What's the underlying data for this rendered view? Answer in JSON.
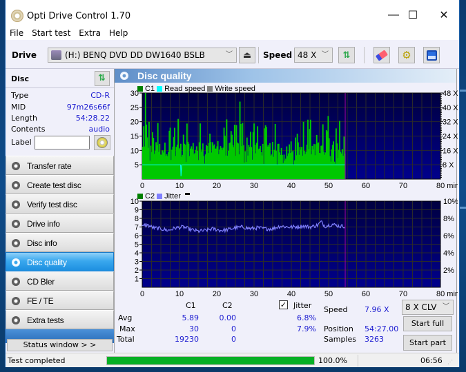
{
  "window": {
    "title": "Opti Drive Control 1.70",
    "controls": {
      "minimize": "—",
      "maximize": "☐",
      "close": "✕"
    }
  },
  "menu": [
    "File",
    "Start test",
    "Extra",
    "Help"
  ],
  "toolbar": {
    "drive_label": "Drive",
    "drive_value": "(H:)   BENQ DVD DD DW1640 BSLB",
    "speed_label": "Speed",
    "speed_value": "48 X",
    "icons": [
      "eject-icon",
      "refresh-icon",
      "erase-icon",
      "settings-icon",
      "save-icon"
    ]
  },
  "disc": {
    "heading": "Disc",
    "fields": [
      {
        "label": "Type",
        "value": "CD-R"
      },
      {
        "label": "MID",
        "value": "97m26s66f"
      },
      {
        "label": "Length",
        "value": "54:28.22"
      },
      {
        "label": "Contents",
        "value": "audio"
      }
    ],
    "label_field": {
      "label": "Label",
      "value": ""
    }
  },
  "nav": [
    {
      "label": "Transfer rate",
      "active": false
    },
    {
      "label": "Create test disc",
      "active": false
    },
    {
      "label": "Verify test disc",
      "active": false
    },
    {
      "label": "Drive info",
      "active": false
    },
    {
      "label": "Disc info",
      "active": false
    },
    {
      "label": "Disc quality",
      "active": true
    },
    {
      "label": "CD Bler",
      "active": false
    },
    {
      "label": "FE / TE",
      "active": false
    },
    {
      "label": "Extra tests",
      "active": false
    }
  ],
  "status_window_button": "Status window > >",
  "panel": {
    "title": "Disc quality"
  },
  "colors": {
    "c1": "#00c800",
    "c2": "#008000",
    "read_speed": "#00ffff",
    "write_speed": "#808080",
    "jitter": "#8080ff",
    "plot_bg_top": "#000040",
    "plot_bg_bottom": "#00008c",
    "end_marker": "#a000a0",
    "progress": "#06b025",
    "value_text": "#1a1ad0"
  },
  "chart_data": [
    {
      "type": "bar",
      "title": "C1 / Read speed",
      "legend": [
        "C1",
        "Read speed",
        "Write speed"
      ],
      "legend_position": "top-left",
      "xlabel": "min",
      "x_ticks": [
        "0",
        "10",
        "20",
        "30",
        "40",
        "50",
        "60",
        "70",
        "80 min"
      ],
      "xlim": [
        0,
        80
      ],
      "ylim": [
        0,
        30
      ],
      "y_ticks": [
        "5",
        "10",
        "15",
        "20",
        "25",
        "30"
      ],
      "y2_ticks": [
        "8 X",
        "16 X",
        "24 X",
        "32 X",
        "40 X",
        "48 X"
      ],
      "y2lim": [
        0,
        48
      ],
      "grid": true,
      "data_end_min": 54.45,
      "series": [
        {
          "name": "C1",
          "profile": "dense bars, baseline ~5-12, frequent spikes 15-23, max 30 near 1 min, 27 near 26 min, 22 near 51 min",
          "max": 30,
          "avg": 5.89
        },
        {
          "name": "Read speed",
          "constant_x": 7.96,
          "dip_at_min": 10.5
        }
      ]
    },
    {
      "type": "line",
      "title": "C2 / Jitter",
      "legend": [
        "C2",
        "Jitter"
      ],
      "legend_position": "top-left",
      "xlabel": "min",
      "x_ticks": [
        "0",
        "10",
        "20",
        "30",
        "40",
        "50",
        "60",
        "70",
        "80 min"
      ],
      "xlim": [
        0,
        80
      ],
      "ylim": [
        0,
        10
      ],
      "y_ticks": [
        "1",
        "2",
        "3",
        "4",
        "5",
        "6",
        "7",
        "8",
        "9",
        "10"
      ],
      "y2_ticks": [
        "2%",
        "4%",
        "6%",
        "8%",
        "10%"
      ],
      "y2lim": [
        0,
        10
      ],
      "grid": true,
      "data_end_min": 54.45,
      "series": [
        {
          "name": "C2",
          "values_all": 0
        },
        {
          "name": "Jitter",
          "unit": "%",
          "x": [
            0,
            1,
            3,
            5,
            7,
            9,
            11,
            13,
            15,
            17,
            19,
            21,
            23,
            25,
            27,
            29,
            31,
            33,
            35,
            37,
            39,
            41,
            43,
            45,
            47,
            48,
            49,
            51,
            53,
            54.4
          ],
          "values": [
            7.0,
            7.3,
            6.9,
            6.8,
            6.6,
            6.9,
            7.0,
            6.7,
            6.5,
            6.6,
            6.8,
            6.6,
            6.7,
            6.9,
            7.0,
            6.8,
            6.9,
            6.8,
            6.8,
            7.1,
            7.0,
            7.0,
            7.1,
            7.0,
            7.2,
            7.6,
            7.1,
            7.3,
            7.1,
            7.1
          ]
        }
      ]
    }
  ],
  "stats": {
    "col_c1": "C1",
    "col_c2": "C2",
    "jitter_label": "Jitter",
    "jitter_checked": true,
    "rows": [
      {
        "label": "Avg",
        "c1": "5.89",
        "c2": "0.00",
        "jitter": "6.8%"
      },
      {
        "label": "Max",
        "c1": "30",
        "c2": "0",
        "jitter": "7.9%"
      },
      {
        "label": "Total",
        "c1": "19230",
        "c2": "0",
        "jitter": ""
      }
    ],
    "speed_label": "Speed",
    "speed_value": "7.96 X",
    "position_label": "Position",
    "position_value": "54:27.00",
    "samples_label": "Samples",
    "samples_value": "3263",
    "speed_mode": "8 X CLV",
    "start_full": "Start full",
    "start_part": "Start part"
  },
  "statusbar": {
    "message": "Test completed",
    "progress": 100.0,
    "progress_text": "100.0%",
    "time": "06:56"
  }
}
